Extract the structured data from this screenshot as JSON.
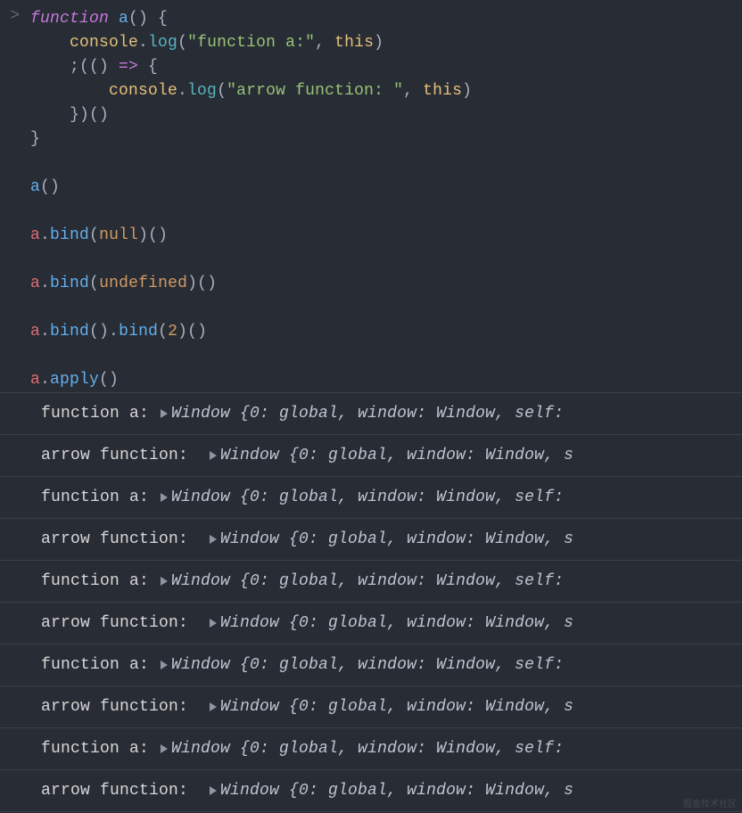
{
  "prompt": ">",
  "code_tokens": [
    [
      [
        "kw",
        "function"
      ],
      [
        "pn",
        " "
      ],
      [
        "fn",
        "a"
      ],
      [
        "pn",
        "() {"
      ]
    ],
    [
      [
        "pn",
        "    "
      ],
      [
        "cons",
        "console"
      ],
      [
        "pn",
        "."
      ],
      [
        "mth",
        "log"
      ],
      [
        "pn",
        "("
      ],
      [
        "str",
        "\"function a:\""
      ],
      [
        "pn",
        ", "
      ],
      [
        "this",
        "this"
      ],
      [
        "pn",
        ")"
      ]
    ],
    [
      [
        "pn",
        "    ;(() "
      ],
      [
        "kw",
        "=>"
      ],
      [
        "pn",
        " {"
      ]
    ],
    [
      [
        "pn",
        "        "
      ],
      [
        "cons",
        "console"
      ],
      [
        "pn",
        "."
      ],
      [
        "mth",
        "log"
      ],
      [
        "pn",
        "("
      ],
      [
        "str",
        "\"arrow function: \""
      ],
      [
        "pn",
        ", "
      ],
      [
        "this",
        "this"
      ],
      [
        "pn",
        ")"
      ]
    ],
    [
      [
        "pn",
        "    })()"
      ]
    ],
    [
      [
        "pn",
        "}"
      ]
    ],
    [],
    [
      [
        "fn",
        "a"
      ],
      [
        "pn",
        "()"
      ]
    ],
    [],
    [
      [
        "id",
        "a"
      ],
      [
        "pn",
        "."
      ],
      [
        "fn",
        "bind"
      ],
      [
        "pn",
        "("
      ],
      [
        "lit",
        "null"
      ],
      [
        "pn",
        ")()"
      ]
    ],
    [],
    [
      [
        "id",
        "a"
      ],
      [
        "pn",
        "."
      ],
      [
        "fn",
        "bind"
      ],
      [
        "pn",
        "("
      ],
      [
        "lit",
        "undefined"
      ],
      [
        "pn",
        ")()"
      ]
    ],
    [],
    [
      [
        "id",
        "a"
      ],
      [
        "pn",
        "."
      ],
      [
        "fn",
        "bind"
      ],
      [
        "pn",
        "()."
      ],
      [
        "fn",
        "bind"
      ],
      [
        "pn",
        "("
      ],
      [
        "num",
        "2"
      ],
      [
        "pn",
        ")()"
      ]
    ],
    [],
    [
      [
        "id",
        "a"
      ],
      [
        "pn",
        "."
      ],
      [
        "fn",
        "apply"
      ],
      [
        "pn",
        "()"
      ]
    ]
  ],
  "output_rows": [
    {
      "label": "function a: ",
      "pad": "",
      "object_repr": "Window {0: global, window: Window, self:"
    },
    {
      "label": "arrow function:  ",
      "pad": "",
      "object_repr": "Window {0: global, window: Window, s"
    },
    {
      "label": "function a: ",
      "pad": "",
      "object_repr": "Window {0: global, window: Window, self:"
    },
    {
      "label": "arrow function:  ",
      "pad": "",
      "object_repr": "Window {0: global, window: Window, s"
    },
    {
      "label": "function a: ",
      "pad": "",
      "object_repr": "Window {0: global, window: Window, self:"
    },
    {
      "label": "arrow function:  ",
      "pad": "",
      "object_repr": "Window {0: global, window: Window, s"
    },
    {
      "label": "function a: ",
      "pad": "",
      "object_repr": "Window {0: global, window: Window, self:"
    },
    {
      "label": "arrow function:  ",
      "pad": "",
      "object_repr": "Window {0: global, window: Window, s"
    },
    {
      "label": "function a: ",
      "pad": "",
      "object_repr": "Window {0: global, window: Window, self:"
    },
    {
      "label": "arrow function:  ",
      "pad": "",
      "object_repr": "Window {0: global, window: Window, s"
    }
  ],
  "watermark": "掘金技术社区"
}
